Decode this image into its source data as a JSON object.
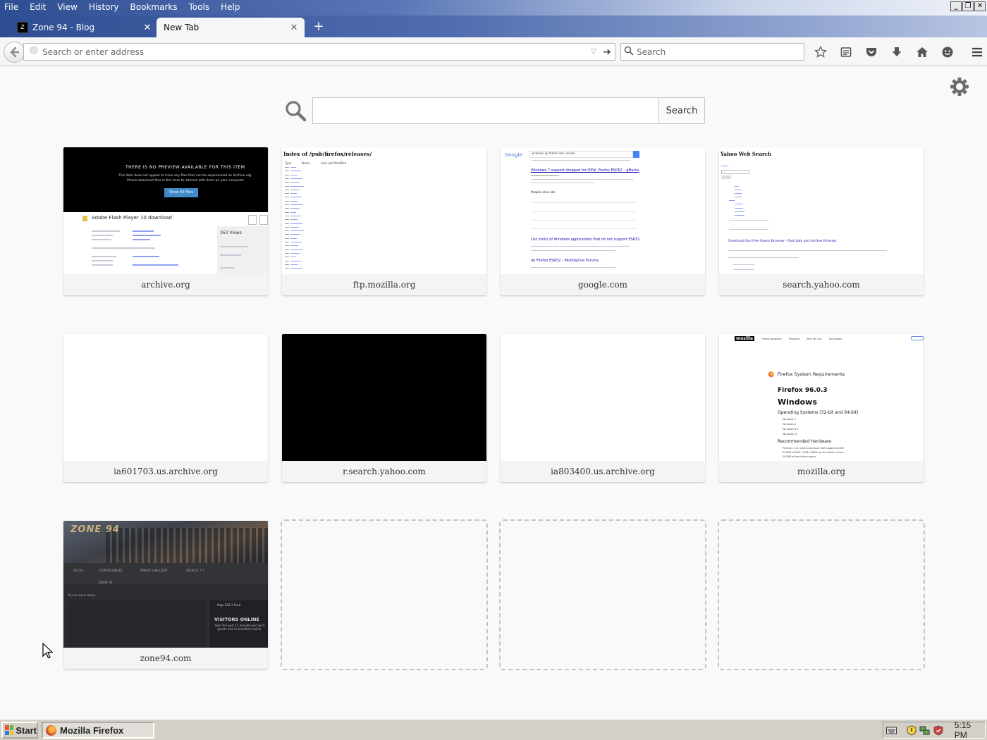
{
  "menu": {
    "file": "File",
    "edit": "Edit",
    "view": "View",
    "history": "History",
    "bookmarks": "Bookmarks",
    "tools": "Tools",
    "help": "Help"
  },
  "tabs": [
    {
      "title": "Zone 94 - Blog",
      "active": false
    },
    {
      "title": "New Tab",
      "active": true
    }
  ],
  "toolbar": {
    "url_placeholder": "Search or enter address",
    "search_placeholder": "Search"
  },
  "newtab": {
    "search_button": "Search",
    "tiles": [
      {
        "title": "archive.org"
      },
      {
        "title": "ftp.mozilla.org"
      },
      {
        "title": "google.com"
      },
      {
        "title": "search.yahoo.com"
      },
      {
        "title": "ia601703.us.archive.org"
      },
      {
        "title": "r.search.yahoo.com"
      },
      {
        "title": "ia803400.us.archive.org"
      },
      {
        "title": "mozilla.org"
      },
      {
        "title": "zone94.com"
      }
    ],
    "thumbs": {
      "archive": {
        "notice": "THERE IS NO PREVIEW AVAILABLE FOR THIS ITEM",
        "sub1": "This item does not appear to have any files that can be experienced on Archive.org.",
        "sub2": "Please download files in this item to interact with them on your computer.",
        "button": "Show All Files",
        "item_title": "Adobe Flash Player 10 download",
        "views": "363 Views"
      },
      "ftp": {
        "heading": "Index of /pub/firefox/releases/",
        "col1": "Type",
        "col2": "Name",
        "col3": "Size  Last Modified"
      },
      "google": {
        "logo": "Google",
        "query": "windows xp firefox last version",
        "result1": "Windows 7 support dropped for OPW, Firefox ESR52 – gHacks",
        "people_also_ask": "People also ask",
        "result2": "List (rolls) of Windows applications that do not support ESR52",
        "result3": "do Firefox ESR52 – MozillaZine Forums"
      },
      "yahoo": {
        "heading": "Yahoo Web Search",
        "link": "Download the Free Opera Browser - Fast Safe and Ad-free Browser"
      },
      "mozilla": {
        "logo": "mozilla",
        "nav": [
          "Firefox Browsers",
          "Products",
          "Who We Are",
          "Innovation"
        ],
        "req_title": "Firefox System Requirements",
        "version": "Firefox 96.0.3",
        "os": "Windows",
        "os_sub": "Operating Systems (32-bit and 64-bit)",
        "os_items": [
          "Windows 7",
          "Windows 8",
          "Windows 8.1",
          "Windows 10"
        ],
        "hw": "Recommended Hardware",
        "hw_items": [
          "Pentium 4 or newer processor that supports SSE2",
          "512MB of RAM / 2GB of RAM for the 64-bit version",
          "200MB of hard drive space"
        ]
      },
      "zone": {
        "logo": "ZONE 94",
        "nav": [
          "BLOG",
          "DOWNLOADS",
          "IMAGE GALLERY",
          "QUACK !!!",
          "SIGN IN"
        ],
        "crumb": "You are here:  Home",
        "widget_head": "Page 933.3 Feed",
        "visitors": "VISITORS ONLINE",
        "visitors_sub": "Over the past 15 minutes we had 0 guests and no members online."
      }
    }
  },
  "taskbar": {
    "start": "Start",
    "task": "Mozilla Firefox",
    "clock": "5:15 PM"
  },
  "colors": {
    "titlebar_start": "#2e4e93",
    "content_bg": "#f9f9fa",
    "taskbar_bg": "#d4d0c8"
  }
}
